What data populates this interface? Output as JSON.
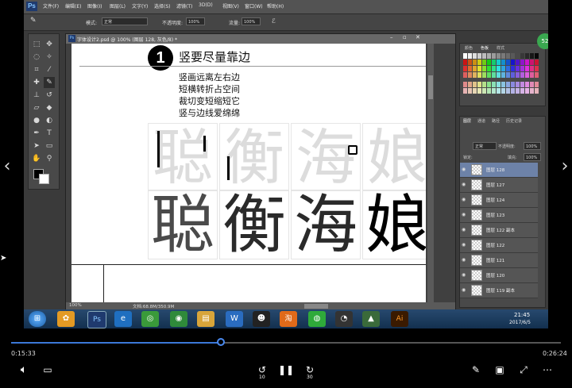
{
  "photoshop": {
    "logo": "Ps",
    "menu": [
      "文件(F)",
      "编辑(E)",
      "图像(I)",
      "图层(L)",
      "文字(Y)",
      "选择(S)",
      "滤镜(T)",
      "3D(D)",
      "视图(V)",
      "窗口(W)",
      "帮助(H)"
    ],
    "options": {
      "mode_label": "模式:",
      "mode_value": "正常",
      "opacity_label": "不透明度:",
      "opacity_value": "100%",
      "flow_label": "流量:",
      "flow_value": "100%"
    },
    "document": {
      "title": "字体设计2.psd @ 100% (图层 128, 灰色/8) *",
      "status_zoom": "100%",
      "status_doc": "文档:68.8M/350.9M"
    },
    "canvas": {
      "step_number": "1",
      "heading": "竖要尽量靠边",
      "rules": [
        "竖画远离左右边",
        "短横转折占空间",
        "裁切变短缩短它",
        "竖与边线爱绵绵"
      ],
      "light_chars": [
        "聪",
        "衡",
        "海",
        "娘"
      ],
      "dark_chars": [
        "聪",
        "衡",
        "海",
        "娘"
      ]
    },
    "panels": {
      "color_tabs": [
        "颜色",
        "色板",
        "样式"
      ],
      "layers_tabs": [
        "图层",
        "通道",
        "路径",
        "历史记录"
      ],
      "blend_mode": "正常",
      "opacity_label": "不透明度:",
      "opacity_value": "100%",
      "lock_label": "锁定:",
      "fill_label": "填充:",
      "fill_value": "100%",
      "layers": [
        {
          "name": "图层 128",
          "active": true
        },
        {
          "name": "图层 127",
          "active": false
        },
        {
          "name": "图层 124",
          "active": false
        },
        {
          "name": "图层 123",
          "active": false
        },
        {
          "name": "图层 122 副本",
          "active": false
        },
        {
          "name": "图层 122",
          "active": false
        },
        {
          "name": "图层 121",
          "active": false
        },
        {
          "name": "图层 120",
          "active": false
        },
        {
          "name": "图层 119 副本",
          "active": false
        }
      ]
    }
  },
  "taskbar": {
    "clock_time": "21:45",
    "clock_date": "2017/6/5"
  },
  "player": {
    "current_time": "0:15:33",
    "total_time": "0:26:24",
    "progress": 0.381,
    "skip_back": "10",
    "skip_forward": "30",
    "accent": "#3b78d8"
  },
  "icons": [
    "volume-icon",
    "subtitles-icon",
    "replay-10-icon",
    "pause-icon",
    "forward-30-icon",
    "pen-icon",
    "miniplayer-icon",
    "fullscreen-icon",
    "more-icon",
    "prev-arrow-icon",
    "next-arrow-icon"
  ]
}
